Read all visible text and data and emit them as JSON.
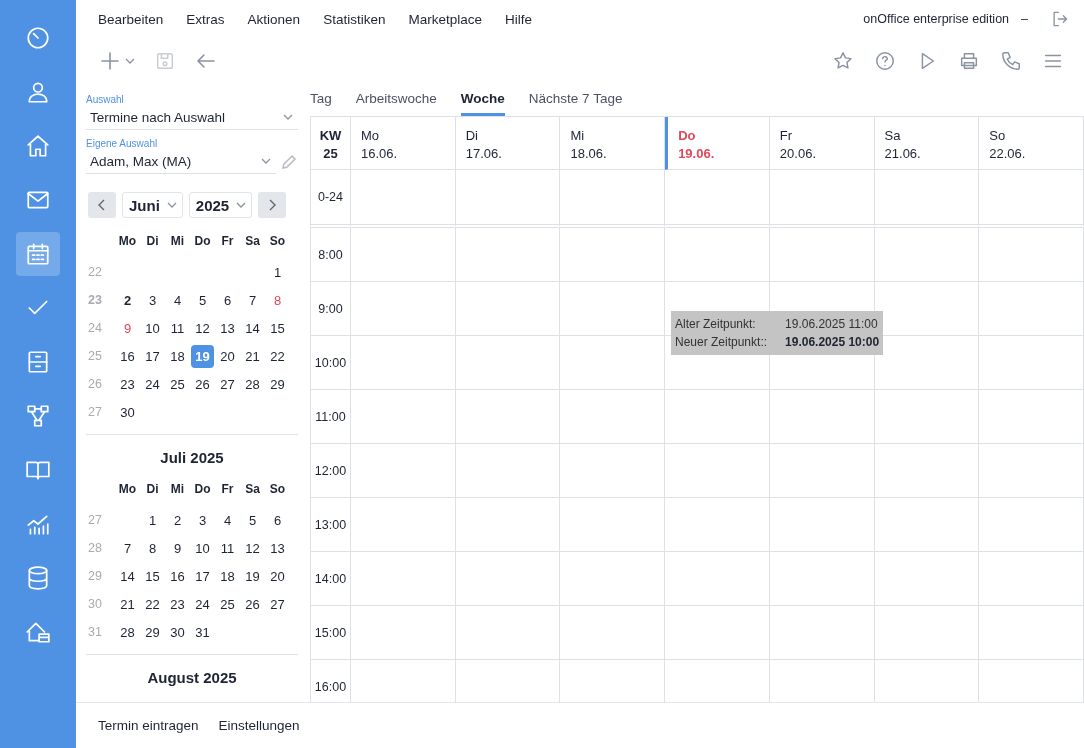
{
  "sidebar": {
    "items": [
      {
        "selected": false
      },
      {
        "selected": false
      },
      {
        "selected": false
      },
      {
        "selected": false
      },
      {
        "selected": true
      },
      {
        "selected": false
      },
      {
        "selected": false
      },
      {
        "selected": false
      },
      {
        "selected": false
      },
      {
        "selected": false
      },
      {
        "selected": false
      },
      {
        "selected": false
      }
    ]
  },
  "menu": [
    "Bearbeiten",
    "Extras",
    "Aktionen",
    "Statistiken",
    "Marketplace",
    "Hilfe"
  ],
  "app_title": "onOffice enterprise edition",
  "minimize": "–",
  "toolbar": {
    "save_disabled": true
  },
  "filters": [
    {
      "label": "Auswahl",
      "value": "Termine nach Auswahl",
      "editable": false
    },
    {
      "label": "Eigene Auswahl",
      "value": "Adam, Max (MA)",
      "editable": true
    }
  ],
  "mini_calendar": {
    "month_select": "Juni",
    "year_select": "2025",
    "months": [
      {
        "weekdays": [
          "Mo",
          "Di",
          "Mi",
          "Do",
          "Fr",
          "Sa",
          "So"
        ],
        "weeks": [
          {
            "kw": "22",
            "kw_bold": false,
            "days": [
              {
                "day": "1",
                "kind": "plain"
              }
            ]
          },
          {
            "kw": "23",
            "kw_bold": true,
            "days": [
              {
                "day": "2",
                "kind": "bold"
              },
              {
                "day": "3",
                "kind": "plain"
              },
              {
                "day": "4",
                "kind": "plain"
              },
              {
                "day": "5",
                "kind": "plain"
              },
              {
                "day": "6",
                "kind": "plain"
              },
              {
                "day": "7",
                "kind": "plain"
              },
              {
                "day": "8",
                "kind": "holiday"
              }
            ]
          },
          {
            "kw": "24",
            "kw_bold": false,
            "days": [
              {
                "day": "9",
                "kind": "holiday"
              },
              {
                "day": "10",
                "kind": "plain"
              },
              {
                "day": "11",
                "kind": "plain"
              },
              {
                "day": "12",
                "kind": "plain"
              },
              {
                "day": "13",
                "kind": "plain"
              },
              {
                "day": "14",
                "kind": "plain"
              },
              {
                "day": "15",
                "kind": "plain"
              }
            ]
          },
          {
            "kw": "25",
            "kw_bold": false,
            "days": [
              {
                "day": "16",
                "kind": "plain"
              },
              {
                "day": "17",
                "kind": "plain"
              },
              {
                "day": "18",
                "kind": "plain"
              },
              {
                "day": "19",
                "kind": "selected"
              },
              {
                "day": "20",
                "kind": "plain"
              },
              {
                "day": "21",
                "kind": "plain"
              },
              {
                "day": "22",
                "kind": "plain"
              }
            ]
          },
          {
            "kw": "26",
            "kw_bold": false,
            "days": [
              {
                "day": "23",
                "kind": "plain"
              },
              {
                "day": "24",
                "kind": "plain"
              },
              {
                "day": "25",
                "kind": "plain"
              },
              {
                "day": "26",
                "kind": "plain"
              },
              {
                "day": "27",
                "kind": "plain"
              },
              {
                "day": "28",
                "kind": "plain"
              },
              {
                "day": "29",
                "kind": "plain"
              }
            ]
          },
          {
            "kw": "27",
            "kw_bold": false,
            "days": [
              {
                "day": "30",
                "kind": "plain"
              }
            ]
          }
        ]
      },
      {
        "title": "Juli 2025",
        "weekdays": [
          "Mo",
          "Di",
          "Mi",
          "Do",
          "Fr",
          "Sa",
          "So"
        ],
        "weeks": [
          {
            "kw": "27",
            "kw_bold": false,
            "days": [
              {
                "day": "1",
                "kind": "plain"
              },
              {
                "day": "2",
                "kind": "plain"
              },
              {
                "day": "3",
                "kind": "plain"
              },
              {
                "day": "4",
                "kind": "plain"
              },
              {
                "day": "5",
                "kind": "plain"
              },
              {
                "day": "6",
                "kind": "plain"
              }
            ]
          },
          {
            "kw": "28",
            "kw_bold": false,
            "days": [
              {
                "day": "7",
                "kind": "plain"
              },
              {
                "day": "8",
                "kind": "plain"
              },
              {
                "day": "9",
                "kind": "plain"
              },
              {
                "day": "10",
                "kind": "plain"
              },
              {
                "day": "11",
                "kind": "plain"
              },
              {
                "day": "12",
                "kind": "plain"
              },
              {
                "day": "13",
                "kind": "plain"
              }
            ]
          },
          {
            "kw": "29",
            "kw_bold": false,
            "days": [
              {
                "day": "14",
                "kind": "plain"
              },
              {
                "day": "15",
                "kind": "plain"
              },
              {
                "day": "16",
                "kind": "plain"
              },
              {
                "day": "17",
                "kind": "plain"
              },
              {
                "day": "18",
                "kind": "plain"
              },
              {
                "day": "19",
                "kind": "plain"
              },
              {
                "day": "20",
                "kind": "plain"
              }
            ]
          },
          {
            "kw": "30",
            "kw_bold": false,
            "days": [
              {
                "day": "21",
                "kind": "plain"
              },
              {
                "day": "22",
                "kind": "plain"
              },
              {
                "day": "23",
                "kind": "plain"
              },
              {
                "day": "24",
                "kind": "plain"
              },
              {
                "day": "25",
                "kind": "plain"
              },
              {
                "day": "26",
                "kind": "plain"
              },
              {
                "day": "27",
                "kind": "plain"
              }
            ]
          },
          {
            "kw": "31",
            "kw_bold": false,
            "days": [
              {
                "day": "28",
                "kind": "plain"
              },
              {
                "day": "29",
                "kind": "plain"
              },
              {
                "day": "30",
                "kind": "plain"
              },
              {
                "day": "31",
                "kind": "plain"
              }
            ]
          }
        ]
      },
      {
        "title": "August 2025"
      }
    ]
  },
  "view_tabs": [
    {
      "label": "Tag",
      "selected": false
    },
    {
      "label": "Arbeitswoche",
      "selected": false
    },
    {
      "label": "Woche",
      "selected": true
    },
    {
      "label": "Nächste 7 Tage",
      "selected": false
    }
  ],
  "week": {
    "kw_label": "KW",
    "kw": "25",
    "allday_label": "0-24",
    "days": [
      {
        "weekday": "Mo",
        "date": "16.06.",
        "today": false
      },
      {
        "weekday": "Di",
        "date": "17.06.",
        "today": false
      },
      {
        "weekday": "Mi",
        "date": "18.06.",
        "today": false
      },
      {
        "weekday": "Do",
        "date": "19.06.",
        "today": true
      },
      {
        "weekday": "Fr",
        "date": "20.06.",
        "today": false
      },
      {
        "weekday": "Sa",
        "date": "21.06.",
        "today": false
      },
      {
        "weekday": "So",
        "date": "22.06.",
        "today": false
      }
    ],
    "hours": [
      "8:00",
      "9:00",
      "10:00",
      "11:00",
      "12:00",
      "13:00",
      "14:00",
      "15:00",
      "16:00"
    ]
  },
  "tooltip": {
    "rows": [
      {
        "label": "Alter Zeitpunkt:",
        "value": "19.06.2025 11:00",
        "emphasized": false
      },
      {
        "label": "Neuer Zeitpunkt::",
        "value": "19.06.2025 10:00",
        "emphasized": true
      }
    ]
  },
  "bottom_bar": [
    "Termin eintragen",
    "Einstellungen"
  ]
}
